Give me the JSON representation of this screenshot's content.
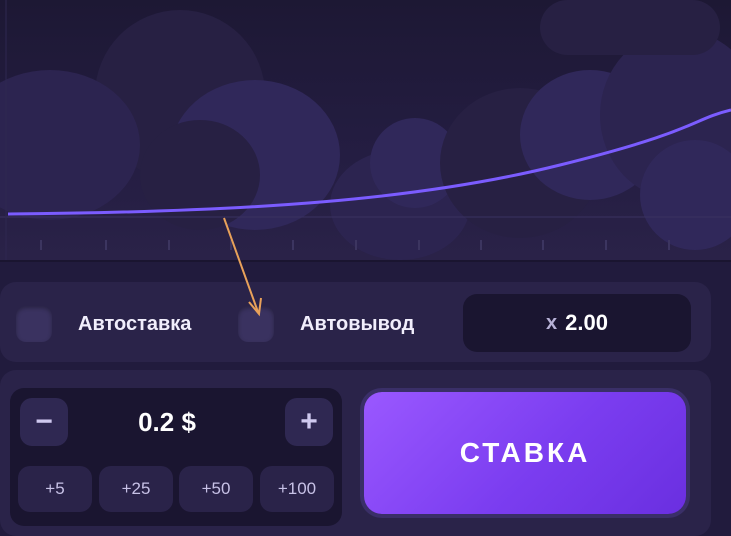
{
  "autobet": {
    "label": "Автоставка"
  },
  "autocashout": {
    "label": "Автовывод",
    "multiplier_prefix": "x",
    "multiplier_value": "2.00"
  },
  "bet": {
    "amount": "0.2 $",
    "decrease_symbol": "−",
    "increase_symbol": "+",
    "quick_amounts": [
      "+5",
      "+25",
      "+50",
      "+100"
    ],
    "submit_label": "СТАВКА"
  },
  "colors": {
    "accent": "#8a4dff",
    "curve": "#7b5cff",
    "annotation_arrow": "#e8a15a"
  },
  "icons": {
    "decrease": "minus-icon",
    "increase": "plus-icon",
    "annotation": "arrow-annotation-icon"
  }
}
